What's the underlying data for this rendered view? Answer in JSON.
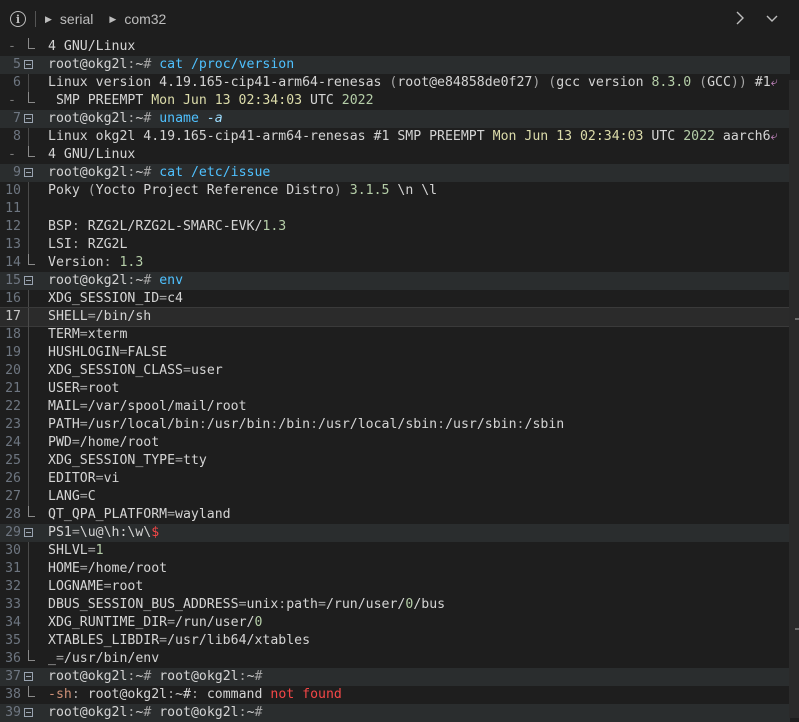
{
  "header": {
    "info_glyph": "i",
    "crumbs": [
      "serial",
      "com32"
    ]
  },
  "lines": [
    {
      "n": "",
      "dash": "-",
      "guide": "end",
      "seg": [
        [
          "d",
          "4 GNU/Linux"
        ]
      ]
    },
    {
      "n": "5",
      "fold": true,
      "hl": true,
      "seg": [
        [
          "d",
          "root@okg2l"
        ],
        [
          "p",
          ":"
        ],
        [
          "d",
          "~"
        ],
        [
          "p",
          "# "
        ],
        [
          "c",
          "cat /proc/version"
        ]
      ]
    },
    {
      "n": "6",
      "guide": "line",
      "seg": [
        [
          "d",
          "Linux version 4.19.165-cip41-arm64-renesas "
        ],
        [
          "p",
          "("
        ],
        [
          "d",
          "root@e84858de0f27"
        ],
        [
          "p",
          ")"
        ],
        [
          "d",
          " "
        ],
        [
          "p",
          "("
        ],
        [
          "d",
          "gcc version "
        ],
        [
          "g",
          "8.3.0"
        ],
        [
          "d",
          " "
        ],
        [
          "p",
          "("
        ],
        [
          "d",
          "GCC"
        ],
        [
          "p",
          "))"
        ],
        [
          "d",
          " #1"
        ],
        [
          "v",
          "⤶"
        ]
      ]
    },
    {
      "n": "",
      "dash": "-",
      "guide": "end",
      "seg": [
        [
          "d",
          " SMP PREEMPT "
        ],
        [
          "y",
          "Mon Jun 13 02:34:03"
        ],
        [
          "d",
          " UTC "
        ],
        [
          "g",
          "2022"
        ]
      ]
    },
    {
      "n": "7",
      "fold": true,
      "hl": true,
      "seg": [
        [
          "d",
          "root@okg2l"
        ],
        [
          "p",
          ":"
        ],
        [
          "d",
          "~"
        ],
        [
          "p",
          "# "
        ],
        [
          "c",
          "uname "
        ],
        [
          "i",
          "-a"
        ]
      ]
    },
    {
      "n": "8",
      "guide": "line",
      "seg": [
        [
          "d",
          "Linux okg2l 4.19.165-cip41-arm64-renesas #1 SMP PREEMPT "
        ],
        [
          "y",
          "Mon Jun 13 02:34:03"
        ],
        [
          "d",
          " UTC "
        ],
        [
          "g",
          "2022"
        ],
        [
          "d",
          " aarch6"
        ],
        [
          "v",
          "⤶"
        ]
      ]
    },
    {
      "n": "",
      "dash": "-",
      "guide": "end",
      "seg": [
        [
          "d",
          "4 GNU/Linux"
        ]
      ]
    },
    {
      "n": "9",
      "fold": true,
      "hl": true,
      "seg": [
        [
          "d",
          "root@okg2l"
        ],
        [
          "p",
          ":"
        ],
        [
          "d",
          "~"
        ],
        [
          "p",
          "# "
        ],
        [
          "c",
          "cat /etc/issue"
        ]
      ]
    },
    {
      "n": "10",
      "guide": "line",
      "seg": [
        [
          "d",
          "Poky "
        ],
        [
          "p",
          "("
        ],
        [
          "d",
          "Yocto Project Reference Distro"
        ],
        [
          "p",
          ")"
        ],
        [
          "d",
          " "
        ],
        [
          "g",
          "3.1.5"
        ],
        [
          "d",
          " \\n \\l"
        ]
      ]
    },
    {
      "n": "11",
      "guide": "line",
      "seg": []
    },
    {
      "n": "12",
      "guide": "line",
      "seg": [
        [
          "d",
          "BSP"
        ],
        [
          "p",
          ":"
        ],
        [
          "d",
          " RZG2L/RZG2L-SMARC-EVK/"
        ],
        [
          "g",
          "1.3"
        ]
      ]
    },
    {
      "n": "13",
      "guide": "line",
      "seg": [
        [
          "d",
          "LSI"
        ],
        [
          "p",
          ":"
        ],
        [
          "d",
          " RZG2L"
        ]
      ]
    },
    {
      "n": "14",
      "guide": "end",
      "seg": [
        [
          "d",
          "Version"
        ],
        [
          "p",
          ":"
        ],
        [
          "d",
          " "
        ],
        [
          "g",
          "1.3"
        ]
      ]
    },
    {
      "n": "15",
      "fold": true,
      "hl": true,
      "seg": [
        [
          "d",
          "root@okg2l"
        ],
        [
          "p",
          ":"
        ],
        [
          "d",
          "~"
        ],
        [
          "p",
          "# "
        ],
        [
          "c",
          "env"
        ]
      ]
    },
    {
      "n": "16",
      "guide": "line",
      "seg": [
        [
          "d",
          "XDG_SESSION_ID"
        ],
        [
          "p",
          "="
        ],
        [
          "d",
          "c4"
        ]
      ]
    },
    {
      "n": "17",
      "guide": "line",
      "cur": true,
      "sel": true,
      "seg": [
        [
          "d",
          "SHELL"
        ],
        [
          "p",
          "="
        ],
        [
          "d",
          "/bin/sh"
        ]
      ]
    },
    {
      "n": "18",
      "guide": "line",
      "seg": [
        [
          "d",
          "TERM"
        ],
        [
          "p",
          "="
        ],
        [
          "d",
          "xterm"
        ]
      ]
    },
    {
      "n": "19",
      "guide": "line",
      "seg": [
        [
          "d",
          "HUSHLOGIN"
        ],
        [
          "p",
          "="
        ],
        [
          "d",
          "FALSE"
        ]
      ]
    },
    {
      "n": "20",
      "guide": "line",
      "seg": [
        [
          "d",
          "XDG_SESSION_CLASS"
        ],
        [
          "p",
          "="
        ],
        [
          "d",
          "user"
        ]
      ]
    },
    {
      "n": "21",
      "guide": "line",
      "seg": [
        [
          "d",
          "USER"
        ],
        [
          "p",
          "="
        ],
        [
          "d",
          "root"
        ]
      ]
    },
    {
      "n": "22",
      "guide": "line",
      "seg": [
        [
          "d",
          "MAIL"
        ],
        [
          "p",
          "="
        ],
        [
          "d",
          "/var/spool/mail/root"
        ]
      ]
    },
    {
      "n": "23",
      "guide": "line",
      "seg": [
        [
          "d",
          "PATH"
        ],
        [
          "p",
          "="
        ],
        [
          "d",
          "/usr/local/bin"
        ],
        [
          "p",
          ":"
        ],
        [
          "d",
          "/usr/bin"
        ],
        [
          "p",
          ":"
        ],
        [
          "d",
          "/bin"
        ],
        [
          "p",
          ":"
        ],
        [
          "d",
          "/usr/local/sbin"
        ],
        [
          "p",
          ":"
        ],
        [
          "d",
          "/usr/sbin"
        ],
        [
          "p",
          ":"
        ],
        [
          "d",
          "/sbin"
        ]
      ]
    },
    {
      "n": "24",
      "guide": "line",
      "seg": [
        [
          "d",
          "PWD"
        ],
        [
          "p",
          "="
        ],
        [
          "d",
          "/home/root"
        ]
      ]
    },
    {
      "n": "25",
      "guide": "line",
      "seg": [
        [
          "d",
          "XDG_SESSION_TYPE"
        ],
        [
          "p",
          "="
        ],
        [
          "d",
          "tty"
        ]
      ]
    },
    {
      "n": "26",
      "guide": "line",
      "seg": [
        [
          "d",
          "EDITOR"
        ],
        [
          "p",
          "="
        ],
        [
          "d",
          "vi"
        ]
      ]
    },
    {
      "n": "27",
      "guide": "line",
      "seg": [
        [
          "d",
          "LANG"
        ],
        [
          "p",
          "="
        ],
        [
          "d",
          "C"
        ]
      ]
    },
    {
      "n": "28",
      "guide": "end",
      "seg": [
        [
          "d",
          "QT_QPA_PLATFORM"
        ],
        [
          "p",
          "="
        ],
        [
          "d",
          "wayland"
        ]
      ]
    },
    {
      "n": "29",
      "fold": true,
      "hl": true,
      "seg": [
        [
          "d",
          "PS1"
        ],
        [
          "p",
          "="
        ],
        [
          "d",
          "\\u@\\h:\\w\\"
        ],
        [
          "r",
          "$"
        ]
      ]
    },
    {
      "n": "30",
      "guide": "line",
      "seg": [
        [
          "d",
          "SHLVL"
        ],
        [
          "p",
          "="
        ],
        [
          "g",
          "1"
        ]
      ]
    },
    {
      "n": "31",
      "guide": "line",
      "seg": [
        [
          "d",
          "HOME"
        ],
        [
          "p",
          "="
        ],
        [
          "d",
          "/home/root"
        ]
      ]
    },
    {
      "n": "32",
      "guide": "line",
      "seg": [
        [
          "d",
          "LOGNAME"
        ],
        [
          "p",
          "="
        ],
        [
          "d",
          "root"
        ]
      ]
    },
    {
      "n": "33",
      "guide": "line",
      "seg": [
        [
          "d",
          "DBUS_SESSION_BUS_ADDRESS"
        ],
        [
          "p",
          "="
        ],
        [
          "d",
          "unix"
        ],
        [
          "p",
          ":"
        ],
        [
          "d",
          "path"
        ],
        [
          "p",
          "="
        ],
        [
          "d",
          "/run/user/"
        ],
        [
          "g",
          "0"
        ],
        [
          "d",
          "/bus"
        ]
      ]
    },
    {
      "n": "34",
      "guide": "line",
      "seg": [
        [
          "d",
          "XDG_RUNTIME_DIR"
        ],
        [
          "p",
          "="
        ],
        [
          "d",
          "/run/user/"
        ],
        [
          "g",
          "0"
        ]
      ]
    },
    {
      "n": "35",
      "guide": "line",
      "seg": [
        [
          "d",
          "XTABLES_LIBDIR"
        ],
        [
          "p",
          "="
        ],
        [
          "d",
          "/usr/lib64/xtables"
        ]
      ]
    },
    {
      "n": "36",
      "guide": "end",
      "seg": [
        [
          "d",
          "_"
        ],
        [
          "p",
          "="
        ],
        [
          "d",
          "/usr/bin/env"
        ]
      ]
    },
    {
      "n": "37",
      "fold": true,
      "hl": true,
      "seg": [
        [
          "d",
          "root@okg2l"
        ],
        [
          "p",
          ":"
        ],
        [
          "d",
          "~"
        ],
        [
          "p",
          "# "
        ],
        [
          "d",
          "root@okg2l"
        ],
        [
          "p",
          ":"
        ],
        [
          "d",
          "~"
        ],
        [
          "p",
          "#"
        ]
      ]
    },
    {
      "n": "38",
      "guide": "end",
      "seg": [
        [
          "o",
          "-sh"
        ],
        [
          "p",
          ":"
        ],
        [
          "d",
          " root@okg2l"
        ],
        [
          "p",
          ":"
        ],
        [
          "d",
          "~#"
        ],
        [
          "p",
          ":"
        ],
        [
          "d",
          " command "
        ],
        [
          "r",
          "not found"
        ]
      ]
    },
    {
      "n": "39",
      "fold": true,
      "hl": true,
      "seg": [
        [
          "d",
          "root@okg2l"
        ],
        [
          "p",
          ":"
        ],
        [
          "d",
          "~"
        ],
        [
          "p",
          "# "
        ],
        [
          "d",
          "root@okg2l"
        ],
        [
          "p",
          ":"
        ],
        [
          "d",
          "~"
        ],
        [
          "p",
          "#"
        ]
      ]
    }
  ]
}
